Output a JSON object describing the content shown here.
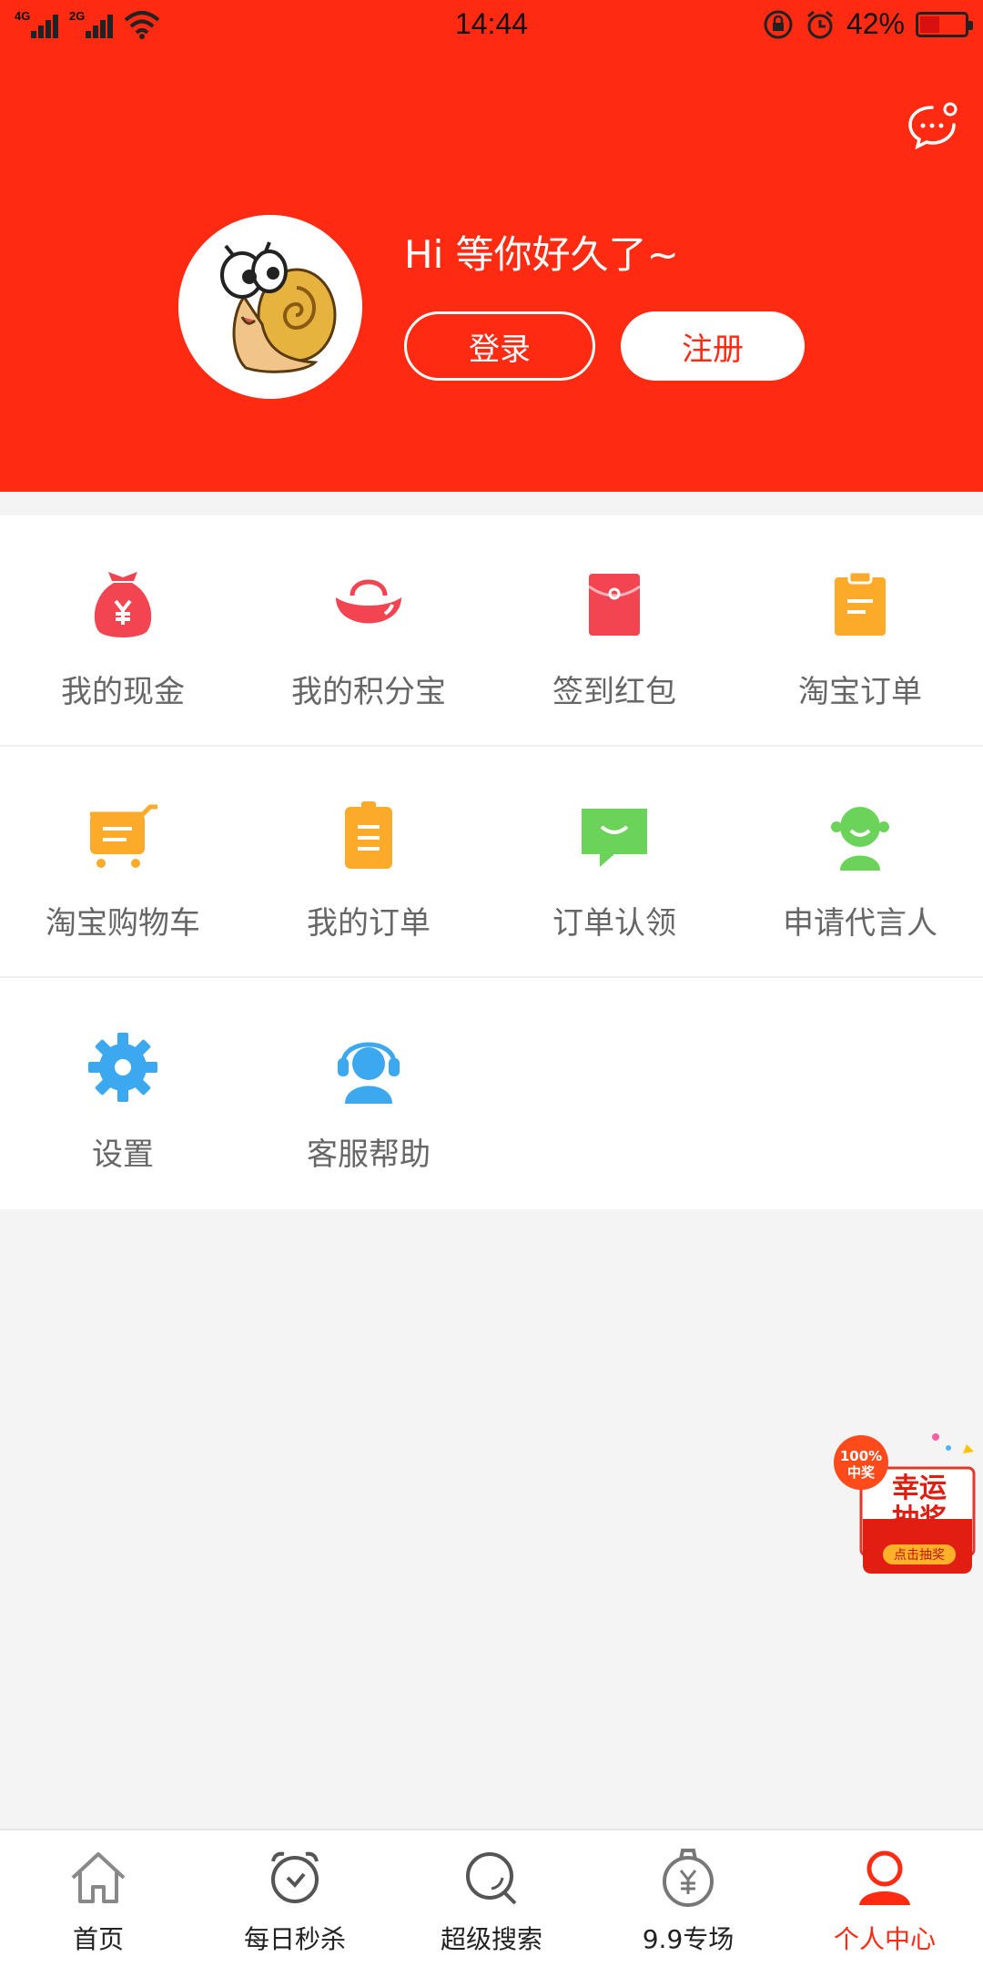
{
  "status_bar": {
    "net1": "4G",
    "net2": "2G",
    "time": "14:44",
    "battery": "42%",
    "battery_level": 0.42
  },
  "header": {
    "greeting": "Hi 等你好久了~",
    "login_label": "登录",
    "register_label": "注册",
    "message_icon": "chat-bubble-icon",
    "bg_color": "#ff2a12"
  },
  "menu": {
    "rows": [
      [
        {
          "label": "我的现金",
          "icon": "money-bag-icon",
          "color": "#f24451"
        },
        {
          "label": "我的积分宝",
          "icon": "ingot-icon",
          "color": "#f24451"
        },
        {
          "label": "签到红包",
          "icon": "red-envelope-icon",
          "color": "#f24451"
        },
        {
          "label": "淘宝订单",
          "icon": "clipboard-icon",
          "color": "#fbaa2a"
        }
      ],
      [
        {
          "label": "淘宝购物车",
          "icon": "cart-icon",
          "color": "#fbaa2a"
        },
        {
          "label": "我的订单",
          "icon": "order-list-icon",
          "color": "#fbaa2a"
        },
        {
          "label": "订单认领",
          "icon": "message-smile-icon",
          "color": "#6cd35a"
        },
        {
          "label": "申请代言人",
          "icon": "spokesperson-icon",
          "color": "#6cd35a"
        }
      ],
      [
        {
          "label": "设置",
          "icon": "gear-icon",
          "color": "#3ba8f0"
        },
        {
          "label": "客服帮助",
          "icon": "headset-icon",
          "color": "#3ba8f0"
        }
      ]
    ]
  },
  "lucky_draw": {
    "badge_line1": "100%",
    "badge_line2": "中奖",
    "title_line1": "幸运",
    "title_line2": "抽奖",
    "button": "点击抽奖"
  },
  "tabbar": {
    "active_color": "#ff2a12",
    "tabs": [
      {
        "label": "首页",
        "icon": "home-icon",
        "active": false
      },
      {
        "label": "每日秒杀",
        "icon": "alarm-clock-icon",
        "active": false
      },
      {
        "label": "超级搜索",
        "icon": "search-icon",
        "active": false
      },
      {
        "label": "9.9专场",
        "icon": "yuan-bag-icon",
        "active": false
      },
      {
        "label": "个人中心",
        "icon": "person-icon",
        "active": true
      }
    ]
  }
}
